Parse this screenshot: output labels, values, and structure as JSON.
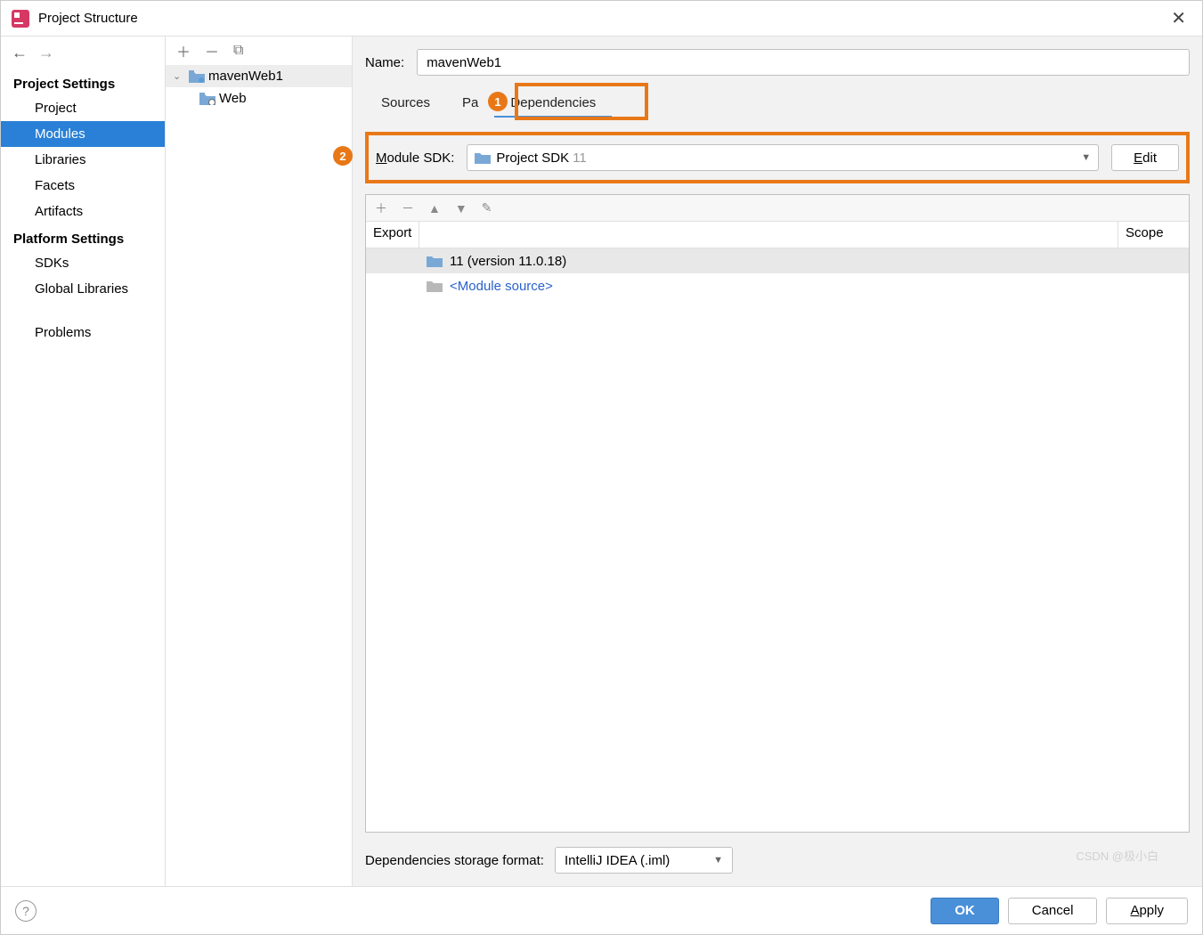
{
  "window": {
    "title": "Project Structure"
  },
  "sidebar": {
    "sections": [
      {
        "title": "Project Settings",
        "items": [
          "Project",
          "Modules",
          "Libraries",
          "Facets",
          "Artifacts"
        ]
      },
      {
        "title": "Platform Settings",
        "items": [
          "SDKs",
          "Global Libraries"
        ]
      }
    ],
    "problems": "Problems",
    "selected": "Modules"
  },
  "tree": {
    "root": "mavenWeb1",
    "children": [
      "Web"
    ]
  },
  "nameRow": {
    "label": "Name:",
    "value": "mavenWeb1"
  },
  "tabs": [
    "Sources",
    "Pa",
    "Dependencies"
  ],
  "activeTab": "Dependencies",
  "sdk": {
    "label_pre": "M",
    "label_rest": "odule SDK:",
    "selected": "Project SDK",
    "version": "11",
    "edit_pre": "E",
    "edit_rest": "dit"
  },
  "depTable": {
    "colExport": "Export",
    "colScope": "Scope",
    "rows": [
      {
        "label": "11 (version 11.0.18)",
        "selected": true,
        "type": "sdk"
      },
      {
        "label": "<Module source>",
        "selected": false,
        "type": "modsrc"
      }
    ]
  },
  "storage": {
    "label": "Dependencies storage format:",
    "value": "IntelliJ IDEA (.iml)"
  },
  "footer": {
    "ok": "OK",
    "cancel": "Cancel",
    "apply_pre": "A",
    "apply_rest": "pply"
  },
  "watermark": "CSDN @极小白"
}
